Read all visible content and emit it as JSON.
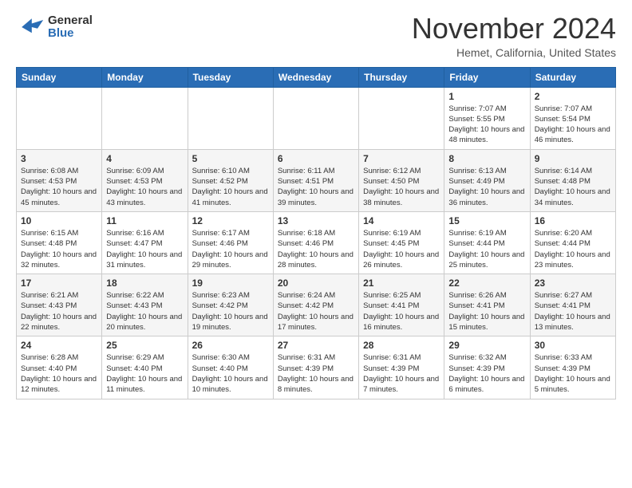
{
  "header": {
    "logo_general": "General",
    "logo_blue": "Blue",
    "month_title": "November 2024",
    "location": "Hemet, California, United States"
  },
  "days_of_week": [
    "Sunday",
    "Monday",
    "Tuesday",
    "Wednesday",
    "Thursday",
    "Friday",
    "Saturday"
  ],
  "weeks": [
    [
      {
        "day": "",
        "info": ""
      },
      {
        "day": "",
        "info": ""
      },
      {
        "day": "",
        "info": ""
      },
      {
        "day": "",
        "info": ""
      },
      {
        "day": "",
        "info": ""
      },
      {
        "day": "1",
        "info": "Sunrise: 7:07 AM\nSunset: 5:55 PM\nDaylight: 10 hours and 48 minutes."
      },
      {
        "day": "2",
        "info": "Sunrise: 7:07 AM\nSunset: 5:54 PM\nDaylight: 10 hours and 46 minutes."
      }
    ],
    [
      {
        "day": "3",
        "info": "Sunrise: 6:08 AM\nSunset: 4:53 PM\nDaylight: 10 hours and 45 minutes."
      },
      {
        "day": "4",
        "info": "Sunrise: 6:09 AM\nSunset: 4:53 PM\nDaylight: 10 hours and 43 minutes."
      },
      {
        "day": "5",
        "info": "Sunrise: 6:10 AM\nSunset: 4:52 PM\nDaylight: 10 hours and 41 minutes."
      },
      {
        "day": "6",
        "info": "Sunrise: 6:11 AM\nSunset: 4:51 PM\nDaylight: 10 hours and 39 minutes."
      },
      {
        "day": "7",
        "info": "Sunrise: 6:12 AM\nSunset: 4:50 PM\nDaylight: 10 hours and 38 minutes."
      },
      {
        "day": "8",
        "info": "Sunrise: 6:13 AM\nSunset: 4:49 PM\nDaylight: 10 hours and 36 minutes."
      },
      {
        "day": "9",
        "info": "Sunrise: 6:14 AM\nSunset: 4:48 PM\nDaylight: 10 hours and 34 minutes."
      }
    ],
    [
      {
        "day": "10",
        "info": "Sunrise: 6:15 AM\nSunset: 4:48 PM\nDaylight: 10 hours and 32 minutes."
      },
      {
        "day": "11",
        "info": "Sunrise: 6:16 AM\nSunset: 4:47 PM\nDaylight: 10 hours and 31 minutes."
      },
      {
        "day": "12",
        "info": "Sunrise: 6:17 AM\nSunset: 4:46 PM\nDaylight: 10 hours and 29 minutes."
      },
      {
        "day": "13",
        "info": "Sunrise: 6:18 AM\nSunset: 4:46 PM\nDaylight: 10 hours and 28 minutes."
      },
      {
        "day": "14",
        "info": "Sunrise: 6:19 AM\nSunset: 4:45 PM\nDaylight: 10 hours and 26 minutes."
      },
      {
        "day": "15",
        "info": "Sunrise: 6:19 AM\nSunset: 4:44 PM\nDaylight: 10 hours and 25 minutes."
      },
      {
        "day": "16",
        "info": "Sunrise: 6:20 AM\nSunset: 4:44 PM\nDaylight: 10 hours and 23 minutes."
      }
    ],
    [
      {
        "day": "17",
        "info": "Sunrise: 6:21 AM\nSunset: 4:43 PM\nDaylight: 10 hours and 22 minutes."
      },
      {
        "day": "18",
        "info": "Sunrise: 6:22 AM\nSunset: 4:43 PM\nDaylight: 10 hours and 20 minutes."
      },
      {
        "day": "19",
        "info": "Sunrise: 6:23 AM\nSunset: 4:42 PM\nDaylight: 10 hours and 19 minutes."
      },
      {
        "day": "20",
        "info": "Sunrise: 6:24 AM\nSunset: 4:42 PM\nDaylight: 10 hours and 17 minutes."
      },
      {
        "day": "21",
        "info": "Sunrise: 6:25 AM\nSunset: 4:41 PM\nDaylight: 10 hours and 16 minutes."
      },
      {
        "day": "22",
        "info": "Sunrise: 6:26 AM\nSunset: 4:41 PM\nDaylight: 10 hours and 15 minutes."
      },
      {
        "day": "23",
        "info": "Sunrise: 6:27 AM\nSunset: 4:41 PM\nDaylight: 10 hours and 13 minutes."
      }
    ],
    [
      {
        "day": "24",
        "info": "Sunrise: 6:28 AM\nSunset: 4:40 PM\nDaylight: 10 hours and 12 minutes."
      },
      {
        "day": "25",
        "info": "Sunrise: 6:29 AM\nSunset: 4:40 PM\nDaylight: 10 hours and 11 minutes."
      },
      {
        "day": "26",
        "info": "Sunrise: 6:30 AM\nSunset: 4:40 PM\nDaylight: 10 hours and 10 minutes."
      },
      {
        "day": "27",
        "info": "Sunrise: 6:31 AM\nSunset: 4:39 PM\nDaylight: 10 hours and 8 minutes."
      },
      {
        "day": "28",
        "info": "Sunrise: 6:31 AM\nSunset: 4:39 PM\nDaylight: 10 hours and 7 minutes."
      },
      {
        "day": "29",
        "info": "Sunrise: 6:32 AM\nSunset: 4:39 PM\nDaylight: 10 hours and 6 minutes."
      },
      {
        "day": "30",
        "info": "Sunrise: 6:33 AM\nSunset: 4:39 PM\nDaylight: 10 hours and 5 minutes."
      }
    ]
  ]
}
